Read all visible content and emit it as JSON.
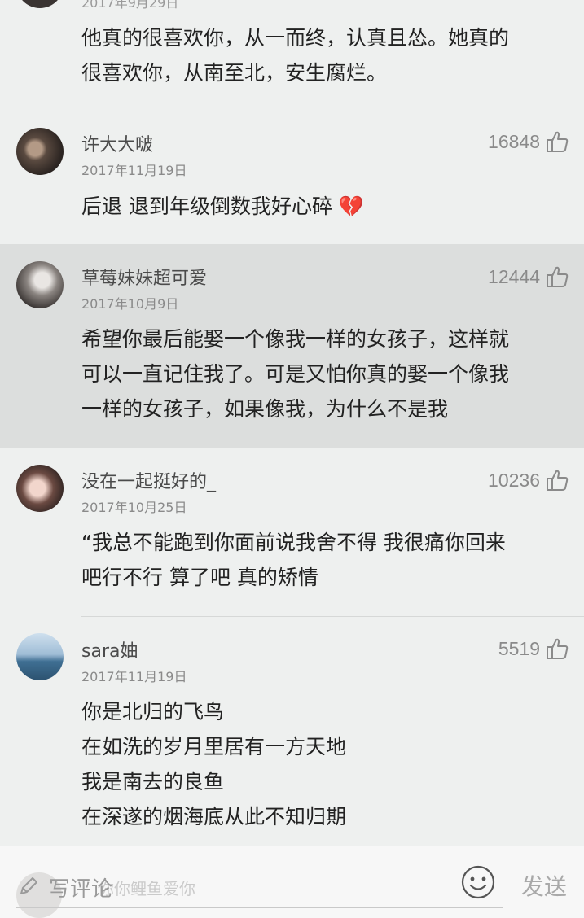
{
  "partial_top": {
    "date": "2017年9月29日",
    "lines": [
      "他真的很喜欢你，从一而终，认真且怂。她真的",
      "很喜欢你，从南至北，安生腐烂。"
    ]
  },
  "comments": [
    {
      "author": "许大大啵",
      "date": "2017年11月19日",
      "likes": "16848",
      "lines": [
        "后退  退到年级倒数我好心碎 💔"
      ]
    },
    {
      "author": "草莓妹妹超可爱",
      "date": "2017年10月9日",
      "likes": "12444",
      "lines": [
        "希望你最后能娶一个像我一样的女孩子，这样就",
        "可以一直记住我了。可是又怕你真的娶一个像我",
        "一样的女孩子，如果像我，为什么不是我"
      ]
    },
    {
      "author": "没在一起挺好的_",
      "date": "2017年10月25日",
      "likes": "10236",
      "lines": [
        "“我总不能跑到你面前说我舍不得 我很痛你回来",
        "吧行不行 算了吧 真的矫情"
      ]
    },
    {
      "author": "sara妯",
      "date": "2017年11月19日",
      "likes": "5519",
      "lines": [
        "你是北归的飞鸟",
        "在如洗的岁月里居有一方天地",
        "我是南去的良鱼",
        "在深遂的烟海底从此不知归期"
      ]
    }
  ],
  "ghost": {
    "author": "你你鲤鱼爱你"
  },
  "bottom_bar": {
    "placeholder": "写评论",
    "send_label": "发送"
  },
  "colors": {
    "highlight": "#dcdedd",
    "background": "#eef0ef"
  }
}
